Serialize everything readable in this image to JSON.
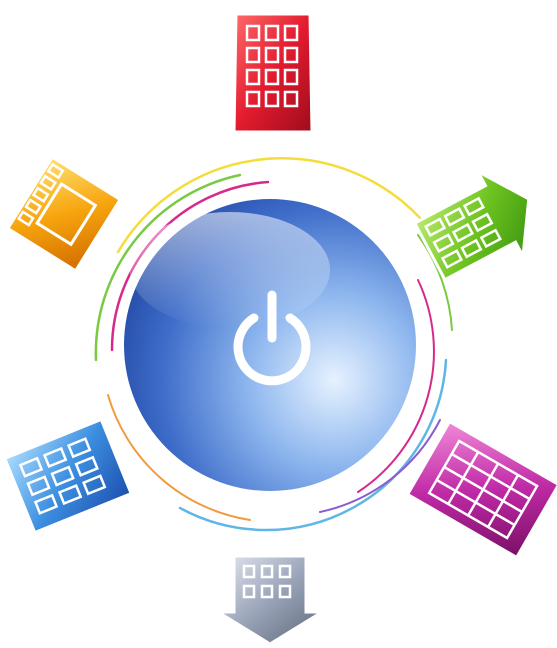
{
  "power_button": {
    "icon": "power-icon",
    "colors": {
      "highlight": "#cfe4ff",
      "mid": "#4f7fd6",
      "shadow": "#1a3f9a"
    }
  },
  "rings": {
    "colors": [
      "#f4dd3a",
      "#7ac943",
      "#d6298c",
      "#5fb6e6"
    ]
  },
  "tiles": [
    {
      "name": "top-tile",
      "icon": "building-grid-icon",
      "color": "#d6172a"
    },
    {
      "name": "top-left-tile",
      "icon": "building-grid-icon",
      "color": "#f5a012"
    },
    {
      "name": "top-right-tile",
      "icon": "building-grid-icon",
      "color": "#6cc21f"
    },
    {
      "name": "bottom-left-tile",
      "icon": "building-grid-icon",
      "color": "#3d8fe0"
    },
    {
      "name": "bottom-right-tile",
      "icon": "building-grid-icon",
      "color": "#b51f9b"
    },
    {
      "name": "bottom-tile",
      "icon": "building-grid-icon",
      "color": "#8a94a8"
    }
  ]
}
